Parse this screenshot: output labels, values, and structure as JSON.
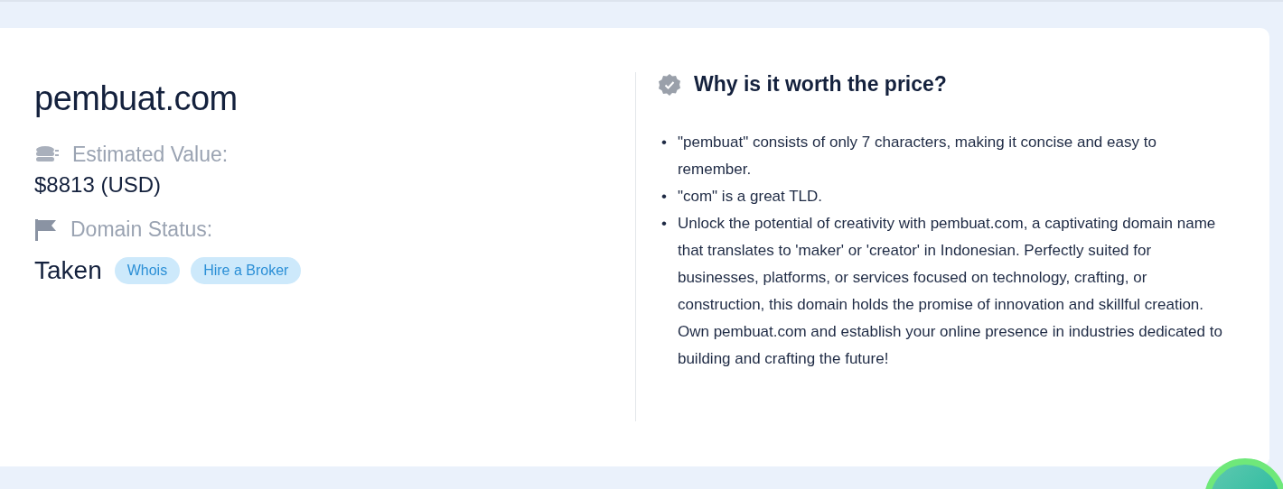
{
  "domain": {
    "name": "pembuat.com",
    "estimated_value": {
      "label": "Estimated Value:",
      "value": "$8813 (USD)"
    },
    "status": {
      "label": "Domain Status:",
      "value": "Taken",
      "links": [
        "Whois",
        "Hire a Broker"
      ]
    }
  },
  "worth": {
    "title": "Why is it worth the price?",
    "points": [
      {
        "marker": "•",
        "text": "\"pembuat\" consists of only 7 characters, making it concise and easy to remember."
      },
      {
        "marker": "•",
        "text": "\"com\" is a great TLD."
      },
      {
        "marker": "•",
        "text": "Unlock the potential of creativity with pembuat.com, a captivating domain name that translates to 'maker' or 'creator' in Indonesian. Perfectly suited for businesses, platforms, or services focused on technology, crafting, or construction, this domain holds the promise of innovation and skillful creation. Own pembuat.com and establish your online presence in industries dedicated to building and crafting the future!"
      }
    ]
  }
}
